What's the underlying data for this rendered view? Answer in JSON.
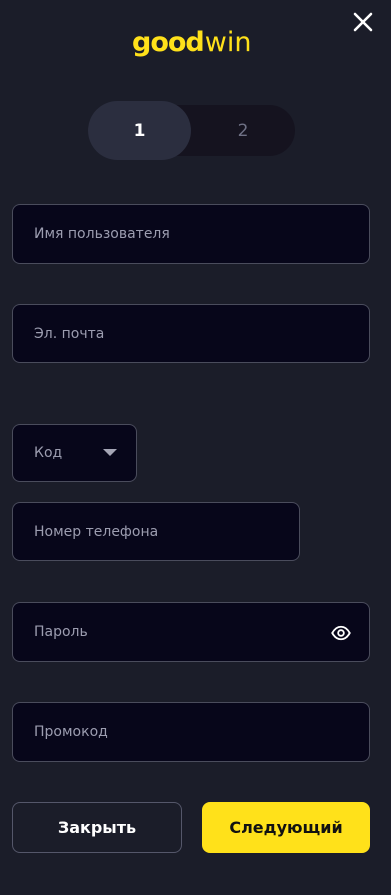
{
  "brand": {
    "logo_bold": "good",
    "logo_light": "win",
    "accent_color": "#ffe11a",
    "logo_icon": "goodwin-logo"
  },
  "header": {
    "close_icon": "close-icon"
  },
  "steps": [
    {
      "label": "1",
      "active": true
    },
    {
      "label": "2",
      "active": false
    }
  ],
  "form": {
    "username_placeholder": "Имя пользователя",
    "email_placeholder": "Эл. почта",
    "code_label": "Код",
    "code_icon": "chevron-down-icon",
    "phone_placeholder": "Номер телефона",
    "password_placeholder": "Пароль",
    "password_icon": "eye-icon",
    "promo_placeholder": "Промокод"
  },
  "actions": {
    "close_label": "Закрыть",
    "next_label": "Следующий"
  }
}
